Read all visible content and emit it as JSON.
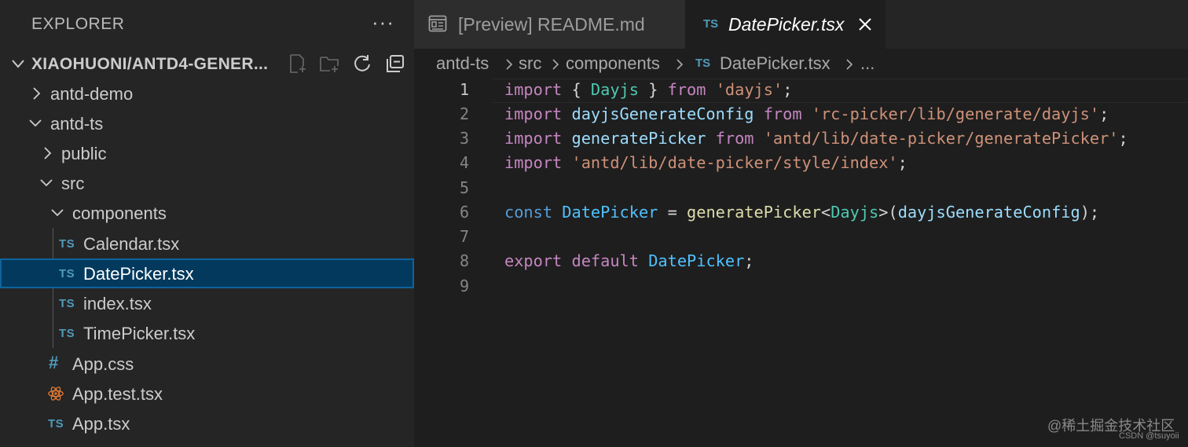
{
  "explorer": {
    "title": "EXPLORER",
    "more": "···",
    "root_label": "XIAOHUONI/ANTD4-GENER...",
    "tree": [
      {
        "label": "antd-demo",
        "kind": "folder",
        "state": "collapsed"
      },
      {
        "label": "antd-ts",
        "kind": "folder",
        "state": "expanded"
      },
      {
        "label": "public",
        "kind": "folder",
        "state": "collapsed"
      },
      {
        "label": "src",
        "kind": "folder",
        "state": "expanded"
      },
      {
        "label": "components",
        "kind": "folder",
        "state": "expanded"
      },
      {
        "label": "Calendar.tsx",
        "kind": "ts",
        "badge": "TS"
      },
      {
        "label": "DatePicker.tsx",
        "kind": "ts",
        "badge": "TS",
        "selected": true
      },
      {
        "label": "index.tsx",
        "kind": "ts",
        "badge": "TS"
      },
      {
        "label": "TimePicker.tsx",
        "kind": "ts",
        "badge": "TS"
      },
      {
        "label": "App.css",
        "kind": "css",
        "badge": "#"
      },
      {
        "label": "App.test.tsx",
        "kind": "react"
      },
      {
        "label": "App.tsx",
        "kind": "ts",
        "badge": "TS"
      }
    ]
  },
  "tabs": [
    {
      "label": "[Preview] README.md",
      "active": false
    },
    {
      "label": "DatePicker.tsx",
      "badge": "TS",
      "active": true
    }
  ],
  "breadcrumb": {
    "items": [
      "antd-ts",
      "src",
      "components",
      "DatePicker.tsx",
      "..."
    ],
    "file_badge": "TS"
  },
  "editor": {
    "line_numbers": [
      "1",
      "2",
      "3",
      "4",
      "5",
      "6",
      "7",
      "8",
      "9"
    ],
    "lines": [
      "import { Dayjs } from 'dayjs';",
      "import dayjsGenerateConfig from 'rc-picker/lib/generate/dayjs';",
      "import generatePicker from 'antd/lib/date-picker/generatePicker';",
      "import 'antd/lib/date-picker/style/index';",
      "",
      "const DatePicker = generatePicker<Dayjs>(dayjsGenerateConfig);",
      "",
      "export default DatePicker;",
      ""
    ]
  },
  "watermark": {
    "line1": "@稀土掘金技术社区",
    "line2": "CSDN @tsuyoii"
  },
  "colors": {
    "keyword_control": "#c586c0",
    "keyword": "#569cd6",
    "type": "#4ec9b0",
    "variable": "#9cdcfe",
    "string": "#ce9178",
    "function": "#dcdcaa",
    "ts_badge": "#519aba",
    "selection": "#04395e"
  }
}
